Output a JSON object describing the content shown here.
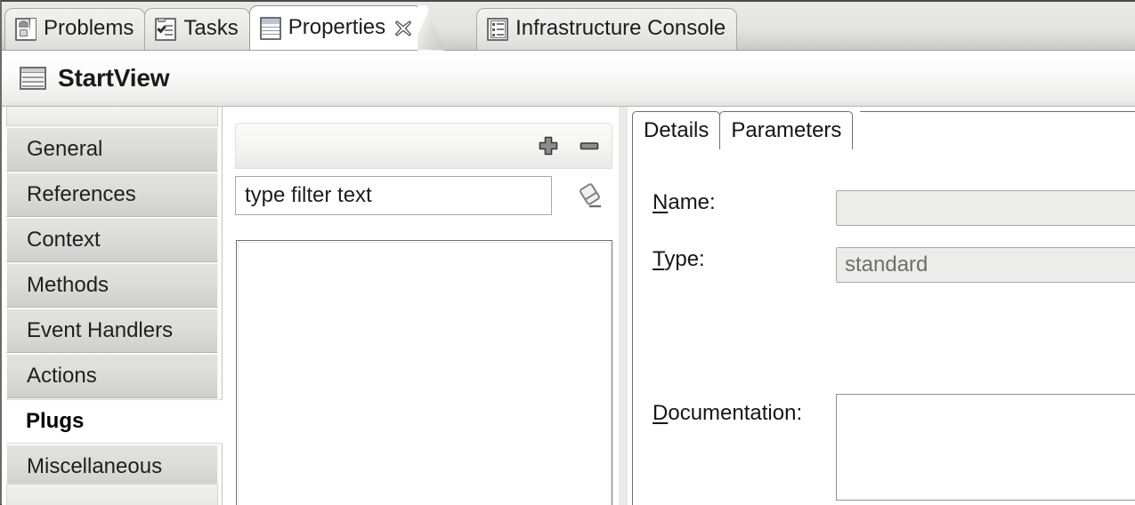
{
  "window": {
    "tabs": [
      {
        "label": "Problems",
        "icon": "problems-icon",
        "active": false
      },
      {
        "label": "Tasks",
        "icon": "tasks-icon",
        "active": false
      },
      {
        "label": "Properties",
        "icon": "properties-table-icon",
        "active": true,
        "closable": true
      },
      {
        "label": "Infrastructure Console",
        "icon": "console-icon",
        "active": false
      }
    ],
    "close_icon": "close-icon"
  },
  "view": {
    "title": "StartView",
    "icon": "view-form-icon"
  },
  "sidebar": {
    "items": [
      {
        "label": "General",
        "selected": false
      },
      {
        "label": "References",
        "selected": false
      },
      {
        "label": "Context",
        "selected": false
      },
      {
        "label": "Methods",
        "selected": false
      },
      {
        "label": "Event Handlers",
        "selected": false
      },
      {
        "label": "Actions",
        "selected": false
      },
      {
        "label": "Plugs",
        "selected": true
      },
      {
        "label": "Miscellaneous",
        "selected": false
      }
    ]
  },
  "middle": {
    "toolbar": {
      "add_label": "",
      "add_icon": "plus-icon",
      "remove_label": "",
      "remove_icon": "minus-icon"
    },
    "filter": {
      "value": "",
      "placeholder": "type filter text",
      "clear_icon": "eraser-icon"
    },
    "list": {
      "items": []
    }
  },
  "details": {
    "tabs": [
      {
        "label": "Details",
        "active": true
      },
      {
        "label": "Parameters",
        "active": false
      }
    ],
    "fields": {
      "name": {
        "label_prefix": "",
        "label_mnemonic": "N",
        "label_suffix": "ame:",
        "value": "",
        "placeholder": "",
        "enabled": false
      },
      "type": {
        "label_prefix": "",
        "label_mnemonic": "T",
        "label_suffix": "ype:",
        "value": "standard",
        "placeholder": "",
        "enabled": false
      },
      "documentation": {
        "label_prefix": "",
        "label_mnemonic": "D",
        "label_suffix": "ocumentation:",
        "value": "",
        "placeholder": "",
        "enabled": true
      }
    }
  },
  "colors": {
    "tab_active_bg": "#ffffff",
    "tab_inactive_bg": "#e8e8e6",
    "nav_item_bg": "#dcdcda",
    "nav_selected_bg": "#ffffff",
    "disabled_field_bg": "#ececea",
    "text": "#1a1a1a"
  }
}
